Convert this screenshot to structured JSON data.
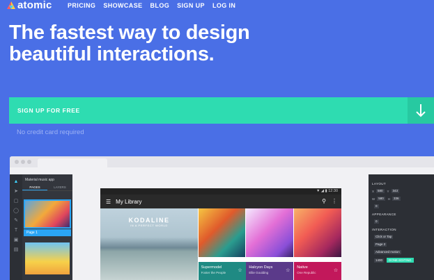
{
  "nav": {
    "brand": "atomic",
    "links": [
      "PRICING",
      "SHOWCASE",
      "BLOG",
      "SIGN UP",
      "LOG IN"
    ]
  },
  "hero": {
    "title_line1": "The fastest way to design",
    "title_line2": "beautiful interactions.",
    "cta_label": "SIGN UP FOR FREE",
    "note": "No credit card required"
  },
  "app": {
    "project_name": "Material music app",
    "panel_tabs": [
      "PAGES",
      "LAYERS"
    ],
    "page_label": "Page 1",
    "phone": {
      "time": "12:30",
      "title": "My Library",
      "feature_title": "KODALINE",
      "feature_subtitle": "IN A PERFECT WORLD",
      "albums": [
        {
          "title": "Supermodel",
          "artist": "Foster the People",
          "color": "#1f8a83"
        },
        {
          "title": "Halcyon Days",
          "artist": "Ellie Goulding",
          "color": "#5b3a8a"
        },
        {
          "title": "Native",
          "artist": "One Republic",
          "color": "#c2185b"
        }
      ]
    },
    "props": {
      "layout_heading": "LAYOUT",
      "x": "580",
      "y": "343",
      "w": "580",
      "h": "336",
      "rotate": "0",
      "appearance_heading": "APPEARANCE",
      "radius": "0",
      "interaction_heading": "INTERACTION",
      "trigger": "Click or Tap",
      "goto": "Page 2",
      "motion": "Advanced motion",
      "duration": "1400",
      "done_label": "DONE EDITING"
    }
  }
}
